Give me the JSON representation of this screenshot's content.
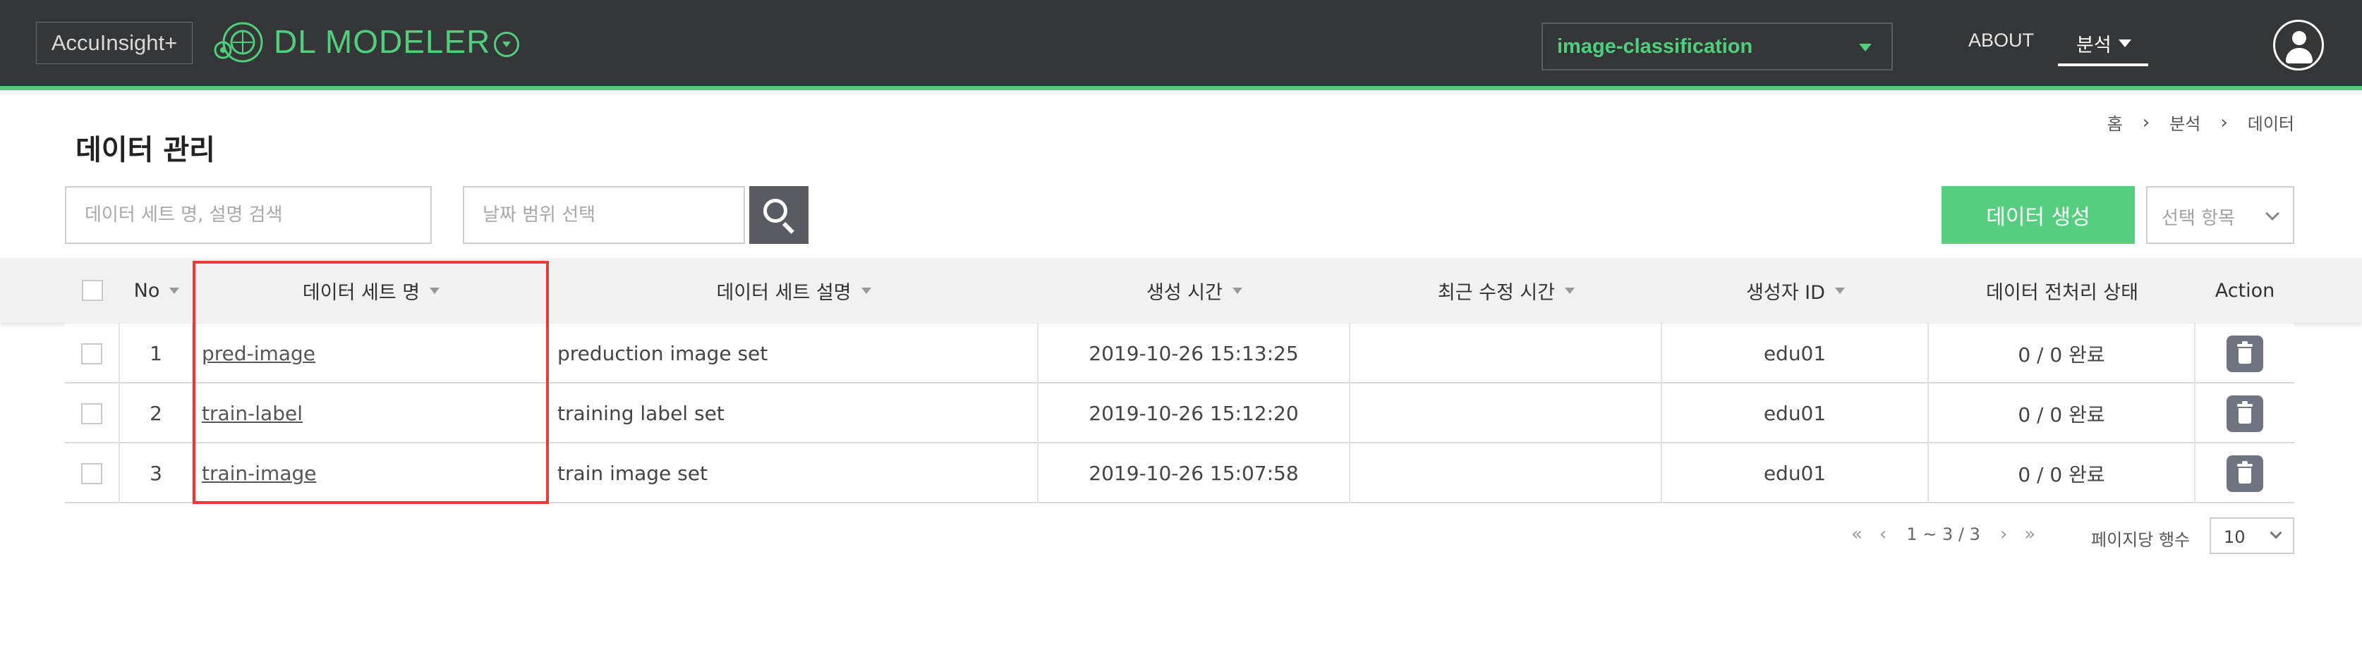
{
  "header": {
    "brand": "AccuInsight+",
    "app_title": "DL MODELER",
    "project_select": "image-classification",
    "nav_about": "ABOUT",
    "nav_analysis": "분석",
    "logo_icon": "brain-circuit-icon",
    "user_icon": "user-avatar-icon",
    "accent_color": "#4fcf7c"
  },
  "page": {
    "title": "데이터 관리",
    "breadcrumb": [
      "홈",
      "분석",
      "데이터"
    ]
  },
  "filters": {
    "search_placeholder": "데이터 세트 명, 설명 검색",
    "date_placeholder": "날짜 범위 선택",
    "search_icon": "search-icon"
  },
  "actions": {
    "create_label": "데이터 생성",
    "select_items_label": "선택 항목",
    "create_color": "#56ce7f"
  },
  "table": {
    "columns": [
      "No",
      "데이터 세트 명",
      "데이터 세트 설명",
      "생성 시간",
      "최근 수정 시간",
      "생성자 ID",
      "데이터 전처리 상태",
      "Action"
    ],
    "rows": [
      {
        "no": "1",
        "name": "pred-image",
        "desc": "preduction image set",
        "created": "2019-10-26 15:13:25",
        "modified": "",
        "creator": "edu01",
        "status": "0 / 0 완료"
      },
      {
        "no": "2",
        "name": "train-label",
        "desc": "training label set",
        "created": "2019-10-26 15:12:20",
        "modified": "",
        "creator": "edu01",
        "status": "0 / 0 완료"
      },
      {
        "no": "3",
        "name": "train-image",
        "desc": "train image set",
        "created": "2019-10-26 15:07:58",
        "modified": "",
        "creator": "edu01",
        "status": "0 / 0 완료"
      }
    ],
    "highlight_color": "#e53b3b"
  },
  "pagination": {
    "first": "«",
    "prev": "‹",
    "info": "1 ~ 3 / 3",
    "next": "›",
    "last": "»",
    "per_page_label": "페이지당 행수",
    "per_page_value": "10"
  }
}
